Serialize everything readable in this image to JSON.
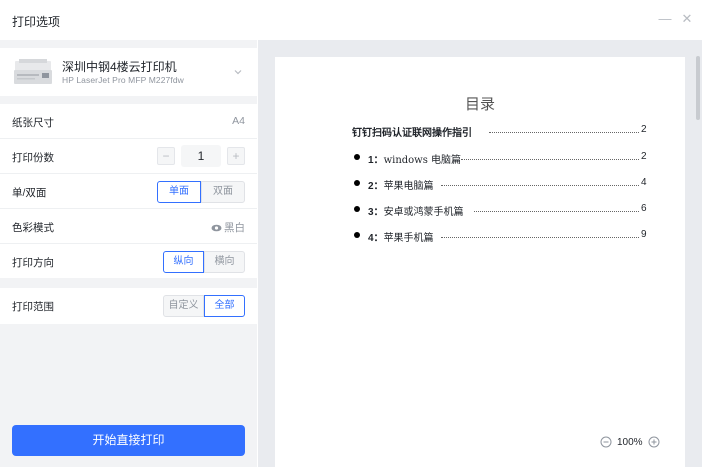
{
  "window": {
    "title": "打印选项",
    "minimize_icon": "minus-icon",
    "close_icon": "close-icon"
  },
  "printer": {
    "name": "深圳中钢4楼云打印机",
    "model": "HP LaserJet Pro MFP M227fdw"
  },
  "settings": {
    "paper_size": {
      "label": "纸张尺寸",
      "value": "A4"
    },
    "copies": {
      "label": "打印份数",
      "value": "1",
      "minus": "−",
      "plus": "+"
    },
    "duplex": {
      "label": "单/双面",
      "options": [
        "单面",
        "双面"
      ],
      "selected": "单面"
    },
    "color_mode": {
      "label": "色彩模式",
      "value": "黑白"
    },
    "orientation": {
      "label": "打印方向",
      "options": [
        "纵向",
        "横向"
      ],
      "selected": "纵向"
    },
    "range": {
      "label": "打印范围",
      "options": [
        "自定义",
        "全部"
      ],
      "selected": "全部"
    }
  },
  "print_button": {
    "label": "开始直接打印"
  },
  "preview": {
    "toc_title": "目录",
    "main_entry": {
      "text": "钉钉扫码认证联网操作指引",
      "page": "2"
    },
    "entries": [
      {
        "num": "1：",
        "text": "windows 电脑篇",
        "page": "2"
      },
      {
        "num": "2：",
        "text": "苹果电脑篇",
        "page": "4"
      },
      {
        "num": "3：",
        "text": "安卓或鸿蒙手机篇",
        "page": "6"
      },
      {
        "num": "4：",
        "text": "苹果手机篇",
        "page": "9"
      }
    ]
  },
  "zoom": {
    "value": "100%"
  },
  "colors": {
    "accent": "#3370ff",
    "panel_bg": "#f2f3f5",
    "preview_bg": "#e9ebef"
  }
}
